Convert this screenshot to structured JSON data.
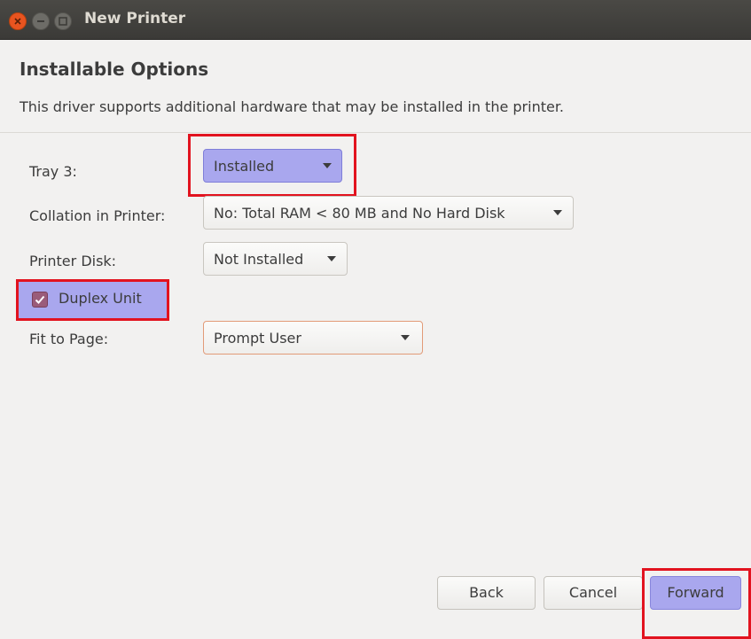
{
  "window": {
    "title": "New Printer",
    "controls": [
      "close-icon",
      "minimize-icon",
      "maximize-icon"
    ]
  },
  "page": {
    "heading": "Installable Options",
    "description": "This driver supports additional hardware that may be installed in the printer."
  },
  "options": {
    "tray3": {
      "label": "Tray 3:",
      "value": "Installed"
    },
    "collation": {
      "label": "Collation in Printer:",
      "value": "No: Total RAM < 80 MB and No Hard Disk"
    },
    "printer_disk": {
      "label": "Printer Disk:",
      "value": "Not Installed"
    },
    "duplex": {
      "label": "Duplex Unit",
      "checked": true
    },
    "fit_to_page": {
      "label": "Fit to Page:",
      "value": "Prompt User"
    }
  },
  "buttons": {
    "back": "Back",
    "cancel": "Cancel",
    "forward": "Forward"
  },
  "colors": {
    "highlight": "#a9a7ee",
    "annotation_border": "#e2131f",
    "close_button": "#e95420",
    "checkbox": "#9a5c7a"
  }
}
